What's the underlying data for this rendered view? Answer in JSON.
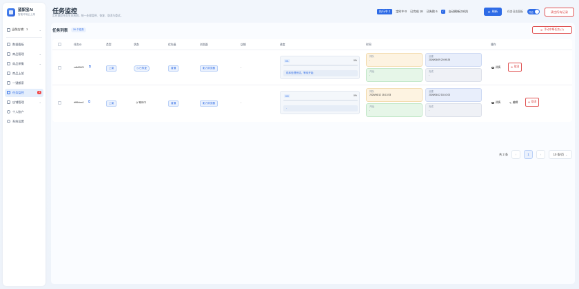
{
  "brand": {
    "name": "蓝貂宝AI",
    "subtitle": "智能环境云上架"
  },
  "store": {
    "label": "当前店铺：1"
  },
  "sidebar": {
    "items": [
      {
        "label": "数据看板",
        "icon": "dashboard-icon"
      },
      {
        "label": "商品管理",
        "icon": "box-icon",
        "expandable": true
      },
      {
        "label": "商品采集",
        "icon": "collect-icon",
        "expandable": true
      },
      {
        "label": "商品上架",
        "icon": "upload-icon"
      },
      {
        "label": "一键搬家",
        "icon": "move-icon"
      },
      {
        "label": "任务监控",
        "icon": "monitor-icon",
        "badge": "1",
        "active": true
      },
      {
        "label": "店铺管理",
        "icon": "store-icon",
        "expandable": true
      },
      {
        "label": "个人账户",
        "icon": "user-icon"
      },
      {
        "label": "系统设置",
        "icon": "settings-icon"
      }
    ]
  },
  "header": {
    "title": "任务监控",
    "description": "实时跟踪任务生命周期，统一处理暂停、恢复、取消与重试。",
    "stats": {
      "running": "执行中 2",
      "scheduled": "定时中 0",
      "completed": "已完成 18",
      "failed": "已失败 6"
    },
    "auto_refresh_label": "自动刷新(15秒)",
    "refresh_button": "刷新",
    "log_label": "任务日志面板",
    "log_toggle": "开启",
    "clear_button": "清空所有记录"
  },
  "list": {
    "title": "任务列表",
    "count": "26 个任务",
    "interrupt_button": "手动中断任务 (1)",
    "columns": [
      "任务ID",
      "类型",
      "状态",
      "优先级",
      "浏览器",
      "店铺",
      "进度",
      "时间",
      "操作"
    ],
    "rows": [
      {
        "id": "cdbf060f",
        "type": "上架",
        "status": "已恢复",
        "priority": "普通",
        "browser": "影刀浏览器",
        "store": "-",
        "progress_head": "0/1",
        "progress_pct": "0%",
        "progress_value": 0,
        "progress_msg": "前序处理完成，等待开始",
        "time": {
          "queue_label": "排队",
          "queue_val": "-",
          "created_label": "创建",
          "created_val": "2026/06/09 20:59:28",
          "start_label": "开始",
          "start_val": "-",
          "done_label": "完成",
          "done_val": "-"
        },
        "actions": [
          "详情",
          "取消"
        ]
      },
      {
        "id": "dff6dea1",
        "type": "上架",
        "status": "等待中",
        "priority": "普通",
        "browser": "影刀浏览器",
        "store": "-",
        "progress_head": "0/0",
        "progress_pct": "0%",
        "progress_value": 0,
        "progress_msg": "-",
        "time": {
          "queue_label": "排队",
          "queue_val": "2026/06/12 18:13:53",
          "created_label": "创建",
          "created_val": "2026/06/12 18:10:03",
          "start_label": "开始",
          "start_val": "-",
          "done_label": "完成",
          "done_val": "-"
        },
        "actions": [
          "详情",
          "编辑",
          "取消"
        ]
      }
    ]
  },
  "pagination": {
    "total": "共 2 条",
    "current": "1",
    "page_size": "10 条/页"
  },
  "colors": {
    "primary": "#2e6be6",
    "danger": "#d94343",
    "badge": "#f24a4a"
  }
}
